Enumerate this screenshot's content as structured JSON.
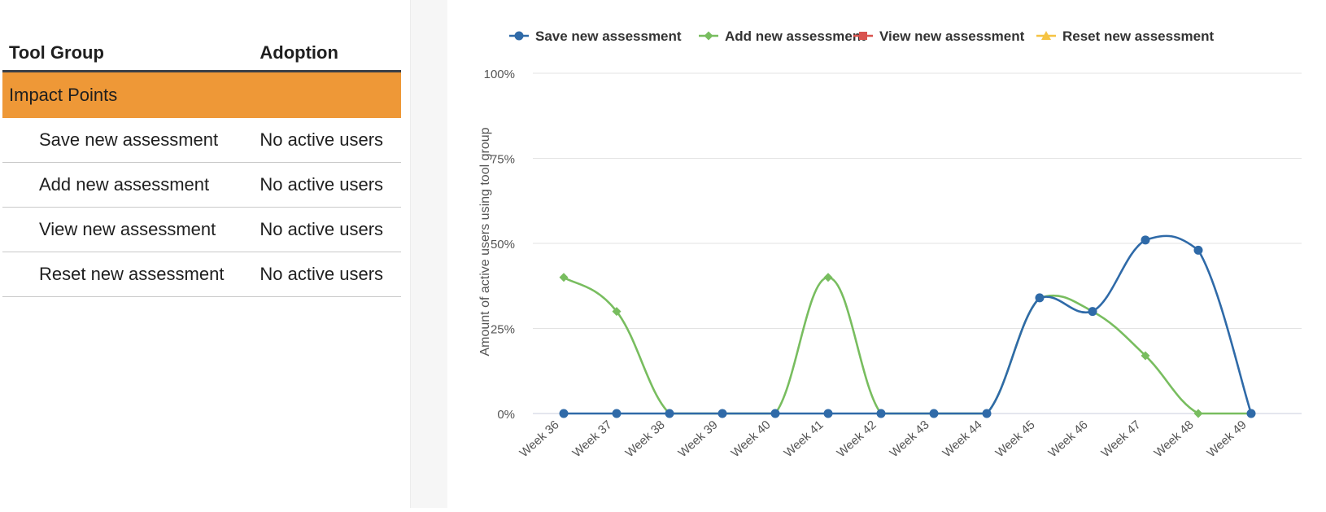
{
  "table": {
    "headers": {
      "tool_group": "Tool Group",
      "adoption": "Adoption"
    },
    "group": {
      "label": "Impact Points"
    },
    "rows": [
      {
        "name": "Save new assessment",
        "adoption": "No active users"
      },
      {
        "name": "Add new assessment",
        "adoption": "No active users"
      },
      {
        "name": "View new assessment",
        "adoption": "No active users"
      },
      {
        "name": "Reset new assessment",
        "adoption": "No active users"
      }
    ]
  },
  "colors": {
    "group_highlight": "#ee9837",
    "save": "#2f6aa8",
    "add": "#78bd5f",
    "view": "#d9534f",
    "reset": "#f5c343"
  },
  "chart_data": {
    "type": "line",
    "title": "",
    "xlabel": "",
    "ylabel": "Amount of active users using tool group",
    "x": [
      "Week 36",
      "Week 37",
      "Week 38",
      "Week 39",
      "Week 40",
      "Week 41",
      "Week 42",
      "Week 43",
      "Week 44",
      "Week 45",
      "Week 46",
      "Week 47",
      "Week 48",
      "Week 49"
    ],
    "y_ticks": [
      "0%",
      "25%",
      "50%",
      "75%",
      "100%"
    ],
    "ylim": [
      0,
      100
    ],
    "grid": true,
    "legend_position": "top",
    "series": [
      {
        "name": "Save new assessment",
        "marker": "circle",
        "color": "#2f6aa8",
        "values": [
          0,
          0,
          0,
          0,
          0,
          0,
          0,
          0,
          0,
          34,
          30,
          51,
          48,
          0
        ]
      },
      {
        "name": "Add new assessment",
        "marker": "diamond",
        "color": "#78bd5f",
        "values": [
          40,
          30,
          0,
          0,
          0,
          40,
          0,
          0,
          0,
          34,
          30,
          17,
          0,
          0
        ]
      },
      {
        "name": "View new assessment",
        "marker": "square",
        "color": "#d9534f",
        "values": []
      },
      {
        "name": "Reset new assessment",
        "marker": "triangle",
        "color": "#f5c343",
        "values": []
      }
    ]
  }
}
